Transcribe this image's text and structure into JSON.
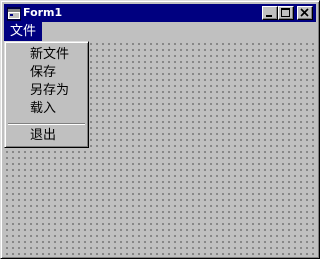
{
  "window": {
    "title": "Form1"
  },
  "menubar": {
    "file_label": "文件"
  },
  "file_menu": {
    "items": [
      {
        "label": "新文件"
      },
      {
        "label": "保存"
      },
      {
        "label": "另存为"
      },
      {
        "label": "载入"
      },
      {
        "label": "退出"
      }
    ]
  },
  "colors": {
    "titlebar": "#000080",
    "face": "#c0c0c0",
    "grid_dots": "#000000"
  },
  "icons": {
    "app": "form-window-icon",
    "minimize": "minimize-icon",
    "maximize": "maximize-icon",
    "close": "close-icon"
  }
}
